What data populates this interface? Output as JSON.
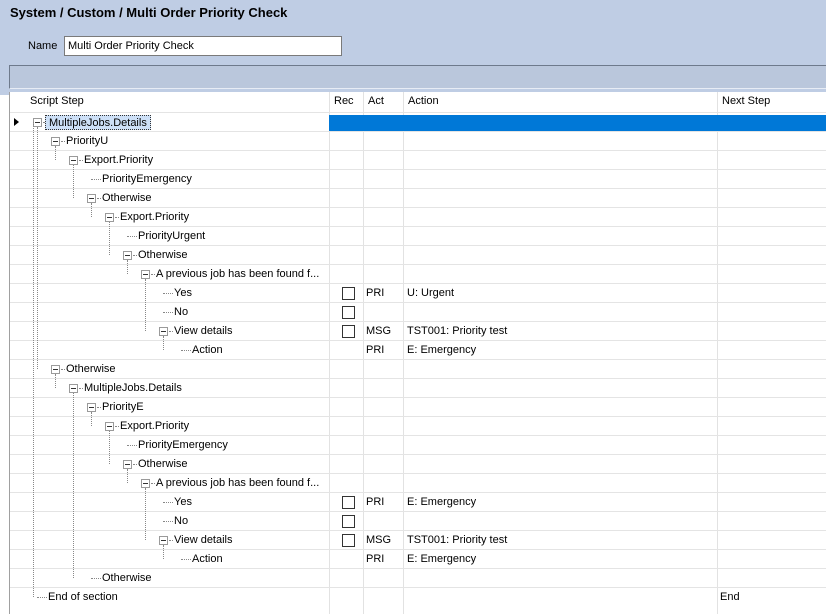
{
  "window": {
    "title": "System / Custom / Multi Order Priority Check",
    "name_label": "Name",
    "name_value": "Multi Order Priority Check"
  },
  "grid": {
    "columns": [
      "Script Step",
      "Rec",
      "Act",
      "Action",
      "Next Step"
    ],
    "rows": [
      {
        "label": "MultipleJobs.Details",
        "level": 0,
        "expander": true,
        "selected": true,
        "checkbox": false,
        "act": "",
        "action": "",
        "next": ""
      },
      {
        "label": "PriorityU",
        "level": 1,
        "expander": true,
        "selected": false,
        "checkbox": false,
        "act": "",
        "action": "",
        "next": ""
      },
      {
        "label": "Export.Priority",
        "level": 2,
        "expander": true,
        "selected": false,
        "checkbox": false,
        "act": "",
        "action": "",
        "next": ""
      },
      {
        "label": "PriorityEmergency",
        "level": 3,
        "expander": false,
        "selected": false,
        "checkbox": false,
        "act": "",
        "action": "",
        "next": ""
      },
      {
        "label": "Otherwise",
        "level": 3,
        "expander": true,
        "selected": false,
        "checkbox": false,
        "act": "",
        "action": "",
        "next": ""
      },
      {
        "label": "Export.Priority",
        "level": 4,
        "expander": true,
        "selected": false,
        "checkbox": false,
        "act": "",
        "action": "",
        "next": ""
      },
      {
        "label": "PriorityUrgent",
        "level": 5,
        "expander": false,
        "selected": false,
        "checkbox": false,
        "act": "",
        "action": "",
        "next": ""
      },
      {
        "label": "Otherwise",
        "level": 5,
        "expander": true,
        "selected": false,
        "checkbox": false,
        "act": "",
        "action": "",
        "next": ""
      },
      {
        "label": "A previous job has been found f...",
        "level": 6,
        "expander": true,
        "selected": false,
        "checkbox": false,
        "act": "",
        "action": "",
        "next": ""
      },
      {
        "label": "Yes",
        "level": 7,
        "expander": false,
        "selected": false,
        "checkbox": true,
        "act": "PRI",
        "action": "U: Urgent",
        "next": ""
      },
      {
        "label": "No",
        "level": 7,
        "expander": false,
        "selected": false,
        "checkbox": true,
        "act": "",
        "action": "",
        "next": ""
      },
      {
        "label": "View details",
        "level": 7,
        "expander": true,
        "selected": false,
        "checkbox": true,
        "act": "MSG",
        "action": "TST001: Priority test",
        "next": ""
      },
      {
        "label": "Action",
        "level": 8,
        "expander": false,
        "selected": false,
        "checkbox": false,
        "act": "PRI",
        "action": "E: Emergency",
        "next": ""
      },
      {
        "label": "Otherwise",
        "level": 1,
        "expander": true,
        "selected": false,
        "checkbox": false,
        "act": "",
        "action": "",
        "next": ""
      },
      {
        "label": "MultipleJobs.Details",
        "level": 2,
        "expander": true,
        "selected": false,
        "checkbox": false,
        "act": "",
        "action": "",
        "next": ""
      },
      {
        "label": "PriorityE",
        "level": 3,
        "expander": true,
        "selected": false,
        "checkbox": false,
        "act": "",
        "action": "",
        "next": ""
      },
      {
        "label": "Export.Priority",
        "level": 4,
        "expander": true,
        "selected": false,
        "checkbox": false,
        "act": "",
        "action": "",
        "next": ""
      },
      {
        "label": "PriorityEmergency",
        "level": 5,
        "expander": false,
        "selected": false,
        "checkbox": false,
        "act": "",
        "action": "",
        "next": ""
      },
      {
        "label": "Otherwise",
        "level": 5,
        "expander": true,
        "selected": false,
        "checkbox": false,
        "act": "",
        "action": "",
        "next": ""
      },
      {
        "label": "A previous job has been found f...",
        "level": 6,
        "expander": true,
        "selected": false,
        "checkbox": false,
        "act": "",
        "action": "",
        "next": ""
      },
      {
        "label": "Yes",
        "level": 7,
        "expander": false,
        "selected": false,
        "checkbox": true,
        "act": "PRI",
        "action": "E: Emergency",
        "next": ""
      },
      {
        "label": "No",
        "level": 7,
        "expander": false,
        "selected": false,
        "checkbox": true,
        "act": "",
        "action": "",
        "next": ""
      },
      {
        "label": "View details",
        "level": 7,
        "expander": true,
        "selected": false,
        "checkbox": true,
        "act": "MSG",
        "action": "TST001: Priority test",
        "next": ""
      },
      {
        "label": "Action",
        "level": 8,
        "expander": false,
        "selected": false,
        "checkbox": false,
        "act": "PRI",
        "action": "E: Emergency",
        "next": ""
      },
      {
        "label": "Otherwise",
        "level": 3,
        "expander": false,
        "selected": false,
        "checkbox": false,
        "act": "",
        "action": "",
        "next": ""
      },
      {
        "label": "End of section",
        "level": 0,
        "expander": false,
        "selected": false,
        "checkbox": false,
        "act": "",
        "action": "",
        "next": "End"
      }
    ]
  },
  "colors": {
    "header_bg": "#bfcde4",
    "selection": "#0078d7"
  }
}
